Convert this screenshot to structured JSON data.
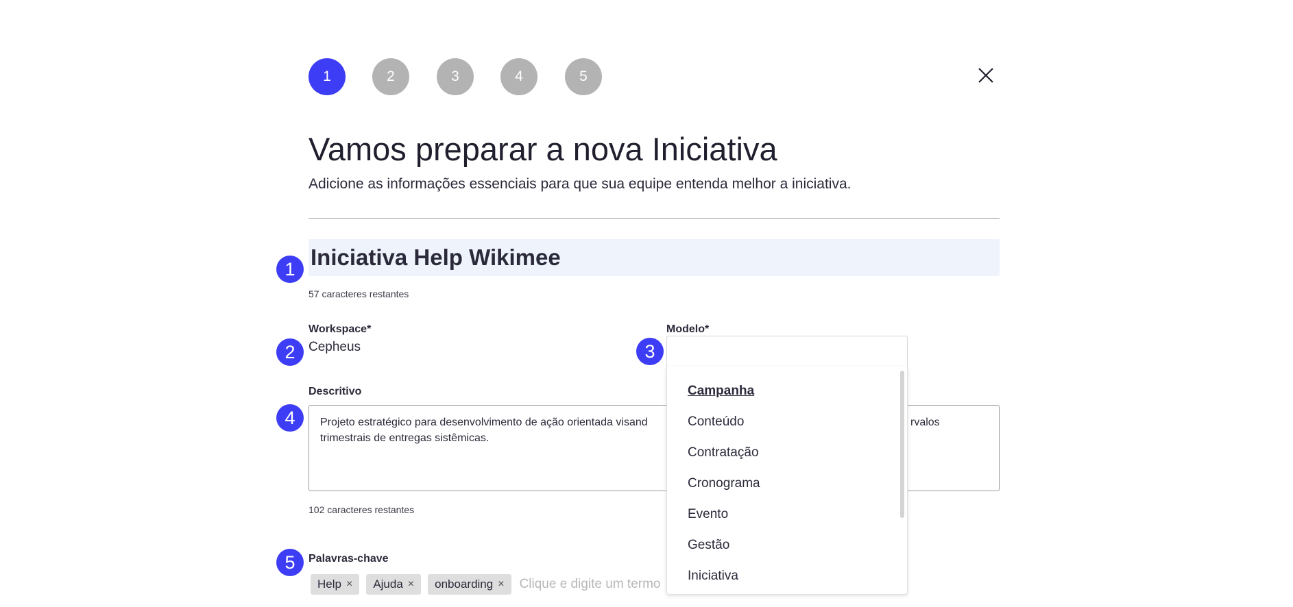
{
  "stepper": {
    "steps": [
      "1",
      "2",
      "3",
      "4",
      "5"
    ],
    "active_step": "1",
    "active_color": "#3d3df5",
    "inactive_color": "#b3b3b3"
  },
  "close_icon": "close-icon",
  "header": {
    "title": "Vamos preparar a nova Iniciativa",
    "subtitle": "Adicione as informações essenciais para que sua equipe entenda melhor a iniciativa."
  },
  "badges": [
    "1",
    "2",
    "3",
    "4",
    "5"
  ],
  "form": {
    "name": {
      "value": "Iniciativa Help Wikimee",
      "hint": "57 caracteres restantes"
    },
    "workspace": {
      "label": "Workspace*",
      "value": "Cepheus"
    },
    "modelo": {
      "label": "Modelo*",
      "value": "",
      "options": [
        "Campanha",
        "Conteúdo",
        "Contratação",
        "Cronograma",
        "Evento",
        "Gestão",
        "Iniciativa"
      ],
      "highlighted": "Campanha"
    },
    "descritivo": {
      "label": "Descritivo",
      "value_line1": "Projeto estratégico para desenvolvimento de ação orientada visand",
      "value_line1_tail": "rvalos",
      "value_line2": "trimestrais de entregas sistêmicas.",
      "hint": "102 caracteres restantes"
    },
    "keywords": {
      "label": "Palavras-chave",
      "tags": [
        "Help",
        "Ajuda",
        "onboarding"
      ],
      "remove_glyph": "×",
      "placeholder": "Clique e digite um termo"
    }
  }
}
